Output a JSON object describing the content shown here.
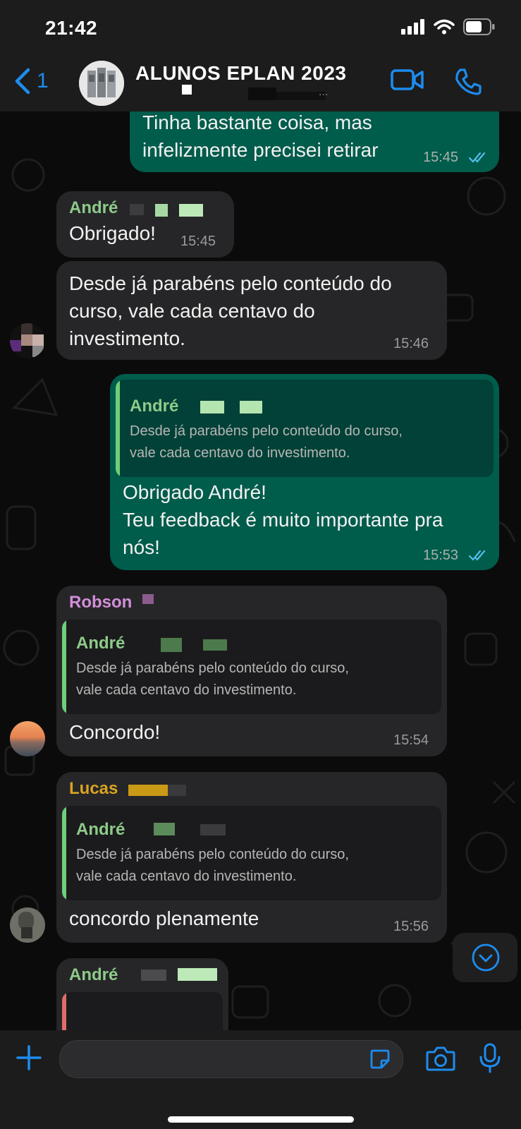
{
  "status_bar": {
    "time": "21:42"
  },
  "header": {
    "back_count": "1",
    "title": "ALUNOS EPLAN 2023",
    "subtitle": "...",
    "icons": [
      "chevron-left-icon",
      "video-call-icon",
      "phone-icon"
    ]
  },
  "messages": [
    {
      "direction": "out",
      "lines": [
        "Tinha bastante coisa, mas",
        "infelizmente precisei retirar"
      ],
      "time": "15:45",
      "status": "read"
    },
    {
      "direction": "in",
      "sender": "André",
      "lines": [
        "Obrigado!"
      ],
      "time": "15:45"
    },
    {
      "direction": "in",
      "lines": [
        "Desde já parabéns pelo conteúdo do",
        "curso, vale cada centavo do",
        "investimento."
      ],
      "time": "15:46"
    },
    {
      "direction": "out",
      "quote": {
        "name": "André",
        "lines": [
          "Desde já parabéns pelo conteúdo do curso,",
          "vale cada centavo do investimento."
        ]
      },
      "lines": [
        "Obrigado André!",
        "Teu feedback é muito importante pra",
        "nós!"
      ],
      "time": "15:53",
      "status": "read"
    },
    {
      "direction": "in",
      "sender": "Robson",
      "quote": {
        "name": "André",
        "lines": [
          "Desde já parabéns pelo conteúdo do curso,",
          "vale cada centavo do investimento."
        ]
      },
      "lines": [
        "Concordo!"
      ],
      "time": "15:54"
    },
    {
      "direction": "in",
      "sender": "Lucas",
      "quote": {
        "name": "André",
        "lines": [
          "Desde já parabéns pelo conteúdo do curso,",
          "vale cada centavo do investimento."
        ]
      },
      "lines": [
        "concordo plenamente"
      ],
      "time": "15:56"
    },
    {
      "direction": "in",
      "sender": "André"
    }
  ],
  "colors": {
    "accent": "#1d8cf0",
    "outgoing": "#005c4b",
    "incoming": "#262628",
    "name_green": "#8ecb8a",
    "name_pink": "#d38fd9",
    "name_yellow": "#d9a321",
    "read_ticks": "#53bdeb"
  }
}
